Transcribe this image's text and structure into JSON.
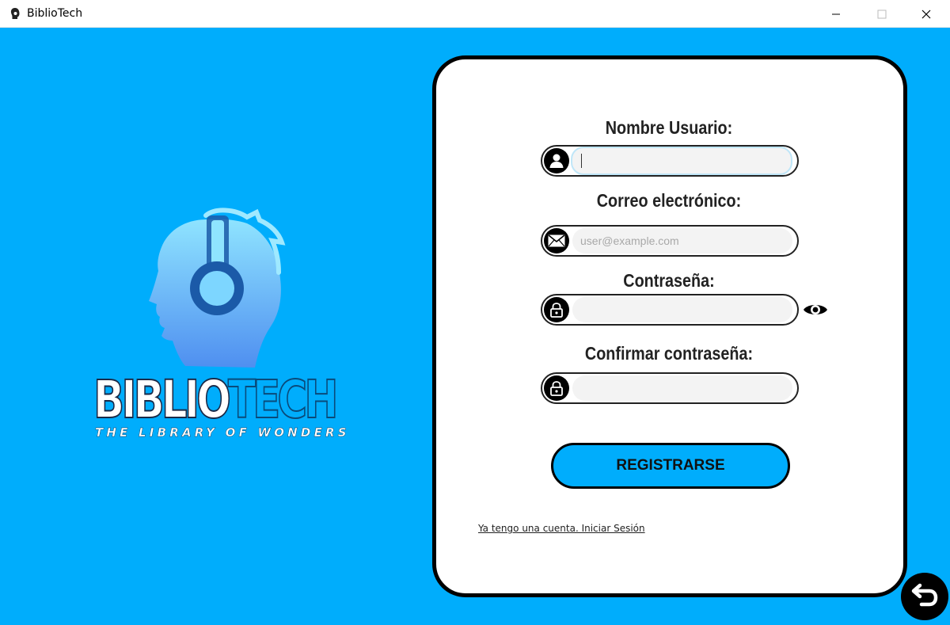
{
  "window": {
    "title": "BiblioTech"
  },
  "brand": {
    "name_part1": "BIBLIO",
    "name_part2": "TECH",
    "tagline": "THE LIBRARY OF WONDERS"
  },
  "form": {
    "username_label": "Nombre Usuario:",
    "username_value": "",
    "email_label": "Correo electrónico:",
    "email_placeholder": "user@example.com",
    "password_label": "Contraseña:",
    "confirm_label": "Confirmar contraseña:",
    "register_label": "REGISTRARSE",
    "login_link": "Ya tengo una cuenta. Iniciar Sesión"
  },
  "colors": {
    "background": "#00adfc",
    "card": "#ffffff",
    "button": "#00adfc",
    "border": "#000000"
  },
  "icons": [
    "app-icon",
    "minimize-icon",
    "maximize-icon",
    "close-icon",
    "user-icon",
    "mail-icon",
    "lock-icon",
    "eye-icon",
    "back-arrow-icon"
  ]
}
